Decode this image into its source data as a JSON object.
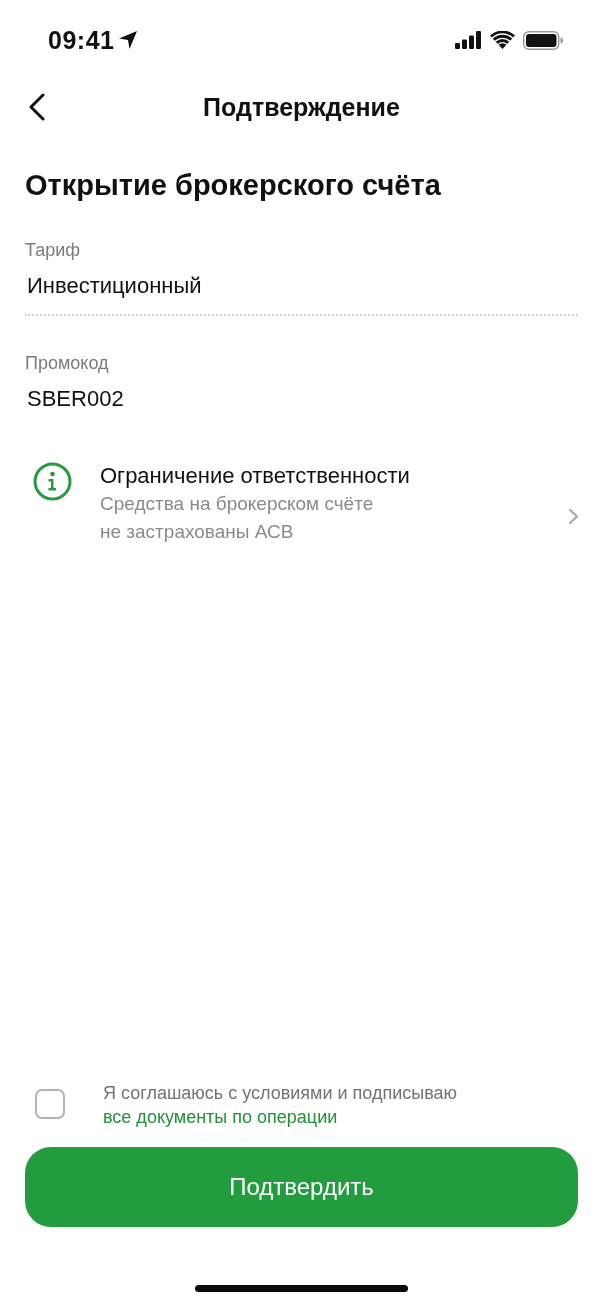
{
  "status_bar": {
    "time": "09:41"
  },
  "nav": {
    "title": "Подтверждение"
  },
  "heading": "Открытие брокерского счёта",
  "fields": [
    {
      "label": "Тариф",
      "value": "Инвестиционный"
    },
    {
      "label": "Промокод",
      "value": "SBER002"
    }
  ],
  "notice": {
    "title": "Ограничение ответственности",
    "text": "Средства на брокерском счёте\nне застрахованы АСВ"
  },
  "consent": {
    "checked": false,
    "text": "Я соглашаюсь с условиями и подписываю",
    "link": "все документы по операции"
  },
  "confirm_button": {
    "label": "Подтвердить"
  }
}
